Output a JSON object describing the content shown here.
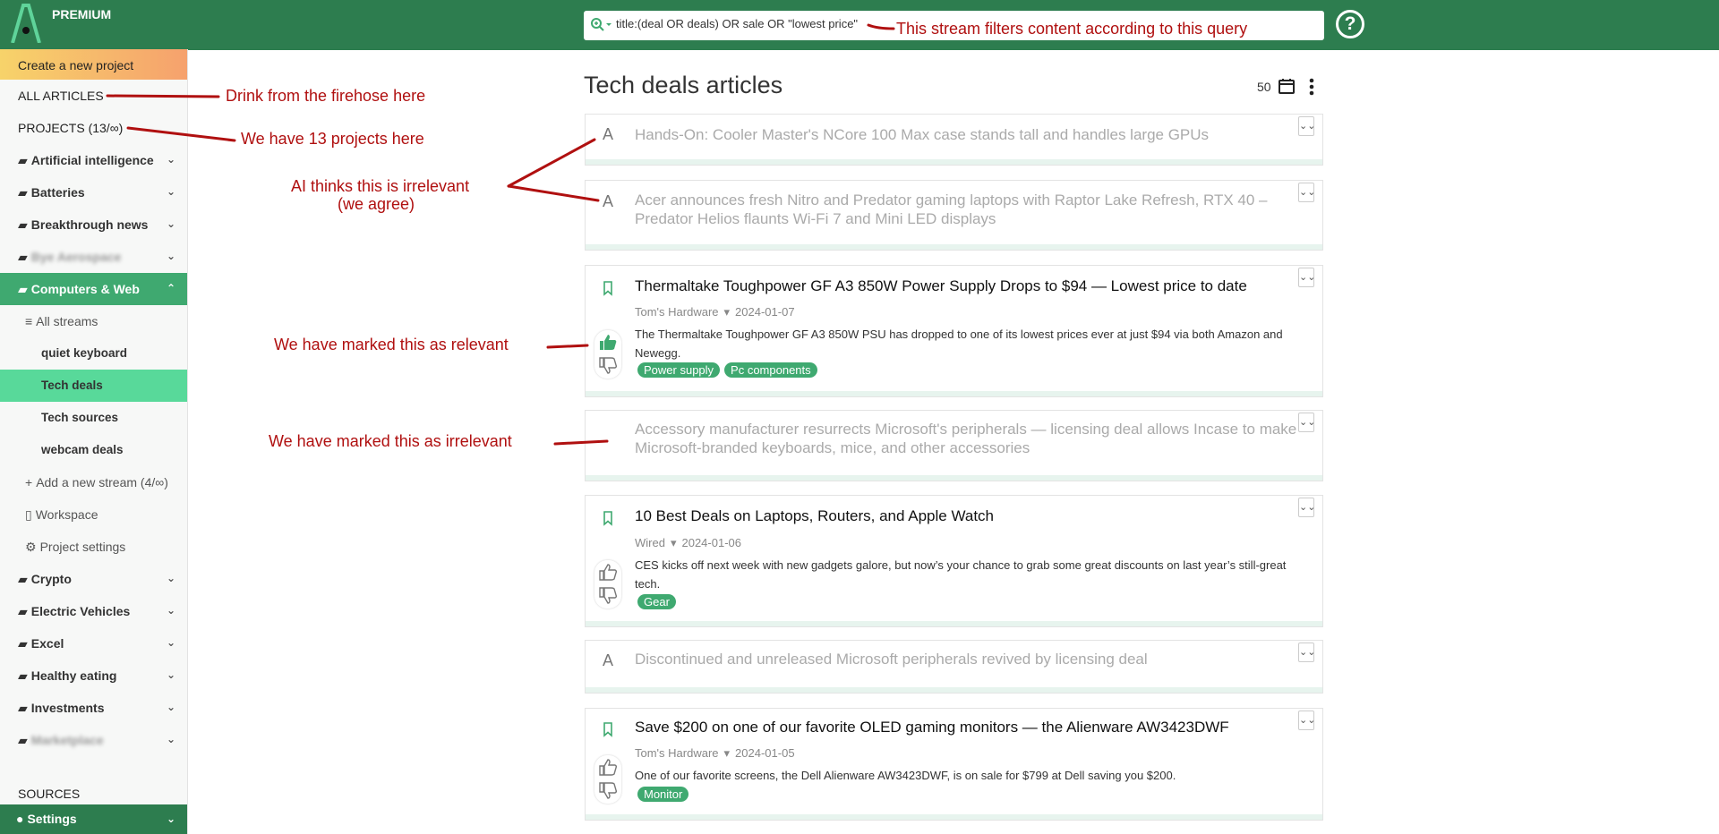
{
  "header": {
    "plan": "PREMIUM",
    "search_query": "title:(deal OR deals) OR sale OR \"lowest price\"",
    "help": "?"
  },
  "sidebar": {
    "create_project": "Create a new project",
    "all_articles": "ALL ARTICLES",
    "projects": "PROJECTS (13/∞)",
    "items": [
      {
        "label": "Artificial intelligence"
      },
      {
        "label": "Batteries"
      },
      {
        "label": "Breakthrough news"
      },
      {
        "label": "Bye Aerospace"
      },
      {
        "label": "Computers & Web"
      },
      {
        "label": "All streams"
      },
      {
        "label": "quiet keyboard"
      },
      {
        "label": "Tech deals"
      },
      {
        "label": "Tech sources"
      },
      {
        "label": "webcam deals"
      },
      {
        "label": "Add a new stream (4/∞)"
      },
      {
        "label": "Workspace"
      },
      {
        "label": "Project settings"
      },
      {
        "label": "Crypto"
      },
      {
        "label": "Electric Vehicles"
      },
      {
        "label": "Excel"
      },
      {
        "label": "Healthy eating"
      },
      {
        "label": "Investments"
      },
      {
        "label": "Marketplace"
      }
    ],
    "sources": "SOURCES",
    "settings": "Settings"
  },
  "main": {
    "title": "Tech deals articles",
    "count": "50",
    "articles": [
      {
        "title": "Hands-On: Cooler Master's NCore 100 Max case stands tall and handles large GPUs"
      },
      {
        "title": "Acer announces fresh Nitro and Predator gaming laptops with Raptor Lake Refresh, RTX 40 – Predator Helios flaunts Wi-Fi 7 and Mini LED displays"
      },
      {
        "title": "Thermaltake Toughpower GF A3 850W Power Supply Drops to $94 — Lowest price to date",
        "source": "Tom's Hardware",
        "date": "2024-01-07",
        "snippet": "The Thermaltake Toughpower GF A3 850W PSU has dropped to one of its lowest prices ever at just $94 via both Amazon and Newegg.",
        "tags": [
          "Power supply",
          "Pc components"
        ]
      },
      {
        "title": "Accessory manufacturer resurrects Microsoft's peripherals — licensing deal allows Incase to make Microsoft-branded keyboards, mice, and other accessories"
      },
      {
        "title": "10 Best Deals on Laptops, Routers, and Apple Watch",
        "source": "Wired",
        "date": "2024-01-06",
        "snippet": "CES kicks off next week with new gadgets galore, but now’s your chance to grab some great discounts on last year’s still-great tech.",
        "tags": [
          "Gear"
        ]
      },
      {
        "title": "Discontinued and unreleased Microsoft peripherals revived by licensing deal"
      },
      {
        "title": "Save $200 on one of our favorite OLED gaming monitors — the Alienware AW3423DWF",
        "source": "Tom's Hardware",
        "date": "2024-01-05",
        "snippet": "One of our favorite screens, the Dell Alienware AW3423DWF, is on sale for $799 at Dell saving you $200.",
        "tags": [
          "Monitor"
        ]
      }
    ]
  },
  "annotations": {
    "query_note": "This stream filters content according to this query",
    "firehose": "Drink from the firehose here",
    "projects_note": "We have 13 projects here",
    "ai_irrelevant_1": "AI thinks this is irrelevant",
    "ai_irrelevant_2": "(we agree)",
    "marked_relevant": "We have marked this as relevant",
    "marked_irrelevant": "We have marked this as irrelevant"
  },
  "colors": {
    "brand_green": "#2d7d4f",
    "active_project": "#3fa970",
    "active_stream": "#58d99a",
    "annotation_red": "#b01010"
  }
}
